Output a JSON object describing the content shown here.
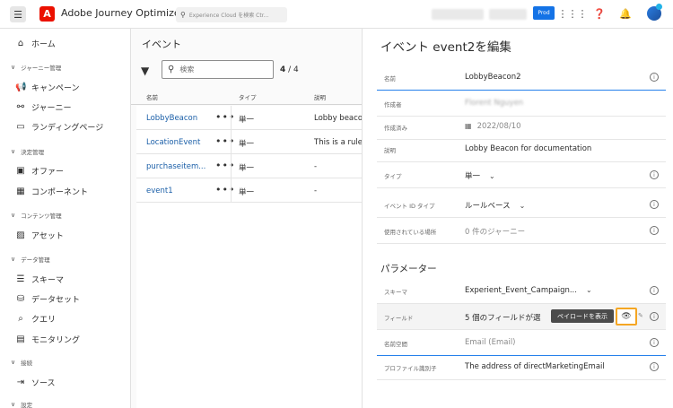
{
  "topbar": {
    "app_title": "Adobe Journey Optimizer",
    "search_placeholder": "Experience Cloud を検索 Ctr...",
    "env_badge": "Prod",
    "logo_glyph": "A"
  },
  "sidebar": {
    "items": [
      {
        "label": "ホーム",
        "icon": "home-icon",
        "glyph": "⌂"
      },
      {
        "section": "ジャーニー管理"
      },
      {
        "label": "キャンペーン",
        "icon": "megaphone-icon",
        "glyph": "📢"
      },
      {
        "label": "ジャーニー",
        "icon": "journey-icon",
        "glyph": "⚯"
      },
      {
        "label": "ランディングページ",
        "icon": "landing-page-icon",
        "glyph": "▭"
      },
      {
        "section": "決定管理"
      },
      {
        "label": "オファー",
        "icon": "offer-icon",
        "glyph": "▣"
      },
      {
        "label": "コンポーネント",
        "icon": "components-icon",
        "glyph": "▦"
      },
      {
        "section": "コンテンツ管理"
      },
      {
        "label": "アセット",
        "icon": "assets-icon",
        "glyph": "▨"
      },
      {
        "section": "データ管理"
      },
      {
        "label": "スキーマ",
        "icon": "schema-icon",
        "glyph": "☰"
      },
      {
        "label": "データセット",
        "icon": "dataset-icon",
        "glyph": "⛁"
      },
      {
        "label": "クエリ",
        "icon": "query-icon",
        "glyph": "⌕"
      },
      {
        "label": "モニタリング",
        "icon": "monitoring-icon",
        "glyph": "▤"
      },
      {
        "section": "接続"
      },
      {
        "label": "ソース",
        "icon": "sources-icon",
        "glyph": "⇥"
      },
      {
        "section": "設定"
      }
    ]
  },
  "events": {
    "title": "イベント",
    "search_placeholder": "検索",
    "count_shown": "4",
    "count_total": "/ 4",
    "columns": {
      "name": "名前",
      "type": "タイプ",
      "desc": "説明"
    },
    "rows": [
      {
        "name": "LobbyBeacon",
        "type": "単一",
        "desc": "Lobby beacon"
      },
      {
        "name": "LocationEvent",
        "type": "単一",
        "desc": "This is a rule-b"
      },
      {
        "name": "purchaseitem...",
        "type": "単一",
        "desc": "-"
      },
      {
        "name": "event1",
        "type": "単一",
        "desc": "-"
      }
    ]
  },
  "edit": {
    "title": "イベント event2を編集",
    "fields": [
      {
        "label": "名前",
        "value": "LobbyBeacon2"
      },
      {
        "label": "作成者",
        "value": "Florent Nguyen"
      },
      {
        "label": "作成済み",
        "value": "2022/08/10"
      },
      {
        "label": "説明",
        "value": "Lobby Beacon for documentation"
      },
      {
        "label": "タイプ",
        "value": "単一"
      },
      {
        "label": "イベント ID タイプ",
        "value": "ルールベース"
      },
      {
        "label": "使用されている場所",
        "value": "0 件のジャーニー"
      }
    ],
    "params_title": "パラメーター",
    "params": [
      {
        "label": "スキーマ",
        "value": "Experient_Event_Campaign..."
      },
      {
        "label": "フィールド",
        "value": "5 個のフィールドが選"
      },
      {
        "label": "名前空間",
        "value": "Email (Email)"
      },
      {
        "label": "プロファイル識別子",
        "value": "The address of directMarketingEmail"
      }
    ],
    "tooltip": "ペイロードを表示"
  }
}
